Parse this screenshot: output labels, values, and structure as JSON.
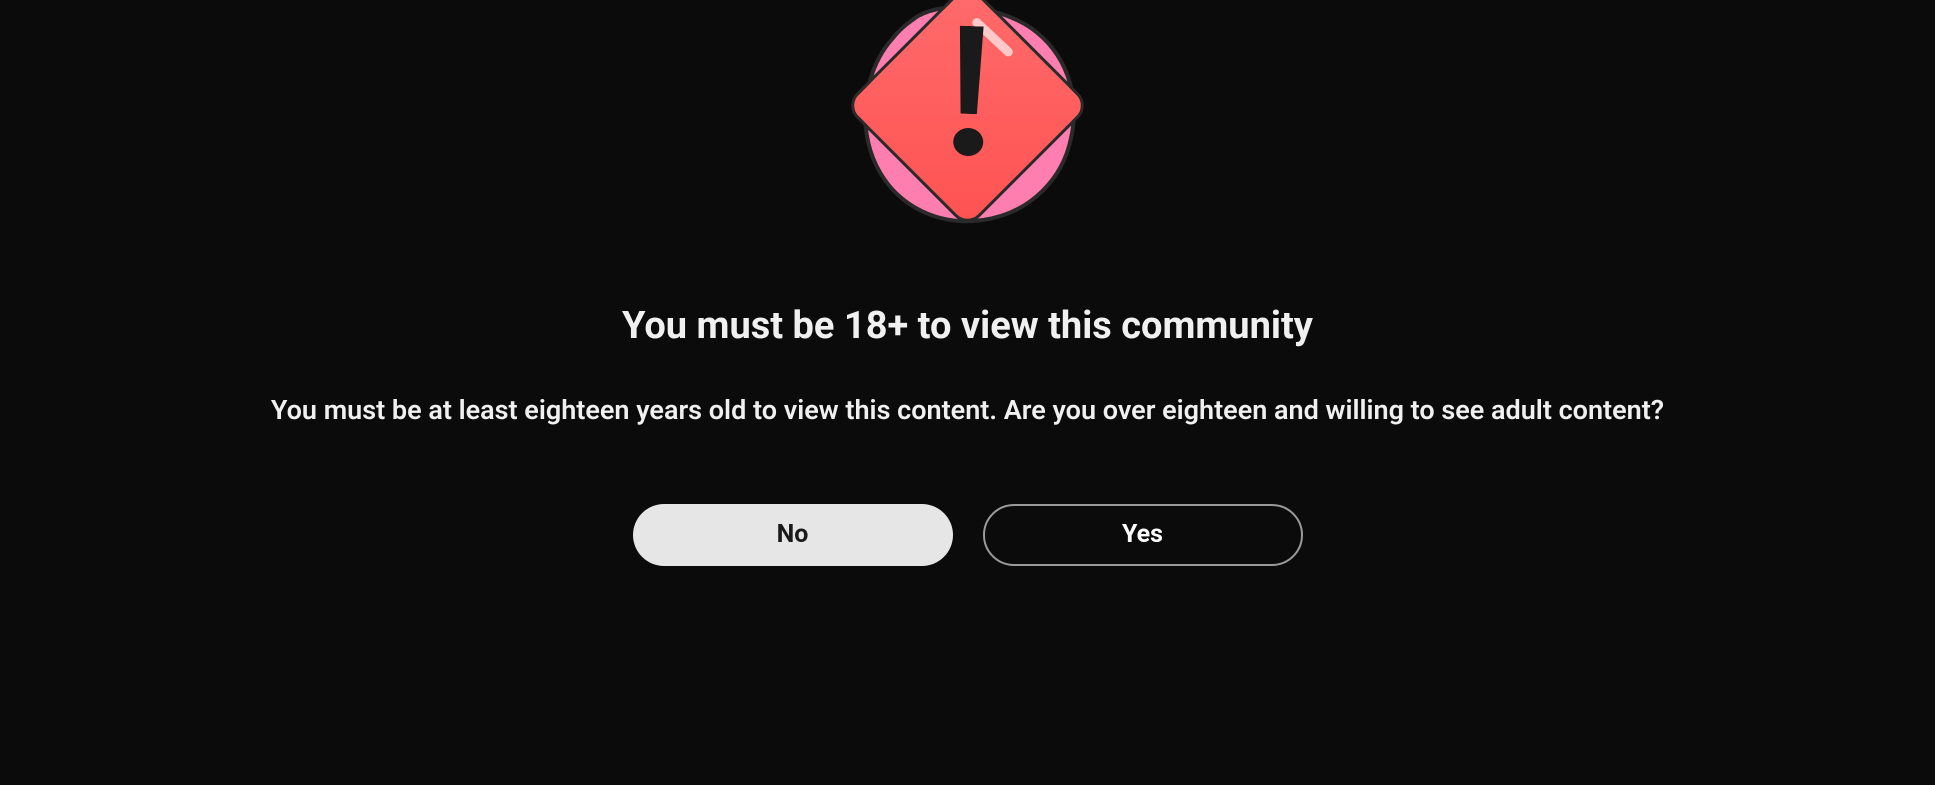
{
  "dialog": {
    "title": "You must be 18+ to view this community",
    "subtitle": "You must be at least eighteen years old to view this content. Are you over eighteen and willing to see adult content?",
    "buttons": {
      "no_label": "No",
      "yes_label": "Yes"
    },
    "icon": "warning-exclamation"
  }
}
